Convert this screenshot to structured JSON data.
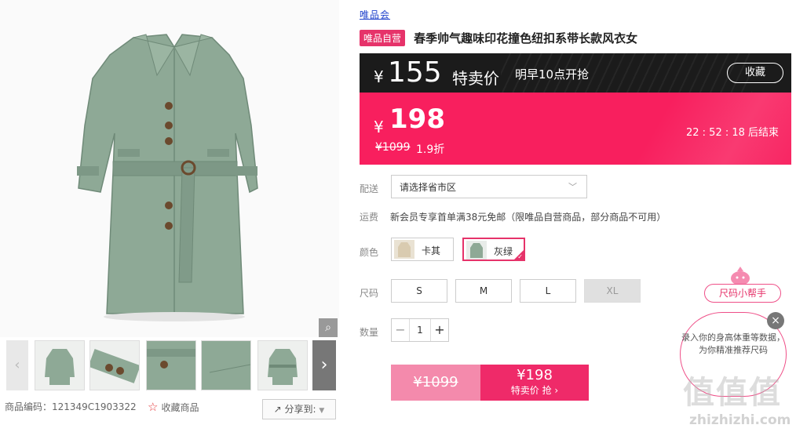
{
  "top_logo": "唯品会",
  "product": {
    "tag": "唯品自营",
    "title": "春季帅气趣味印花撞色纽扣系带长款风衣女"
  },
  "presale": {
    "currency": "¥",
    "price": "155",
    "label": "特卖价",
    "time": "明早10点开抢",
    "collect_label": "收藏"
  },
  "current": {
    "currency": "¥",
    "price": "198",
    "original": "¥1099",
    "discount": "1.9折",
    "countdown": "22 : 52 : 18  后结束"
  },
  "delivery": {
    "label": "配送",
    "placeholder": "请选择省市区"
  },
  "shipping": {
    "label": "运费",
    "text": "新会员专享首单满38元免邮（限唯品自营商品，部分商品不可用）"
  },
  "color": {
    "label": "颜色",
    "options": [
      {
        "name": "卡其",
        "swatch": "#d9cbb0",
        "selected": false
      },
      {
        "name": "灰绿",
        "swatch": "#8ea996",
        "selected": true
      }
    ]
  },
  "size": {
    "label": "尺码",
    "options": [
      "S",
      "M",
      "L",
      "XL"
    ],
    "disabled": [
      "XL"
    ]
  },
  "quantity": {
    "label": "数量",
    "value": "1",
    "minus": "−",
    "plus": "+"
  },
  "buy": {
    "left_price": "¥1099",
    "right_price": "¥198",
    "right_label": "特卖价 抢 ›"
  },
  "gallery": {
    "zoom_icon": "magnifier-icon",
    "prev_icon": "‹",
    "next_icon": "›"
  },
  "meta": {
    "code": "商品编码：121349C1903322",
    "favorite": "收藏商品",
    "share": "分享到:"
  },
  "helper": {
    "tab": "尺码小帮手",
    "bubble": "录入你的身高体重等数据，为你精准推荐尺码",
    "close": "×"
  },
  "watermark": {
    "big": "值值值",
    "site": "zhizhizhi.com"
  },
  "colors": {
    "brand_pink": "#f81f5e",
    "dark_bar": "#1b1b1b",
    "tag_pink": "#e6336a",
    "coat_green": "#8ea996"
  }
}
